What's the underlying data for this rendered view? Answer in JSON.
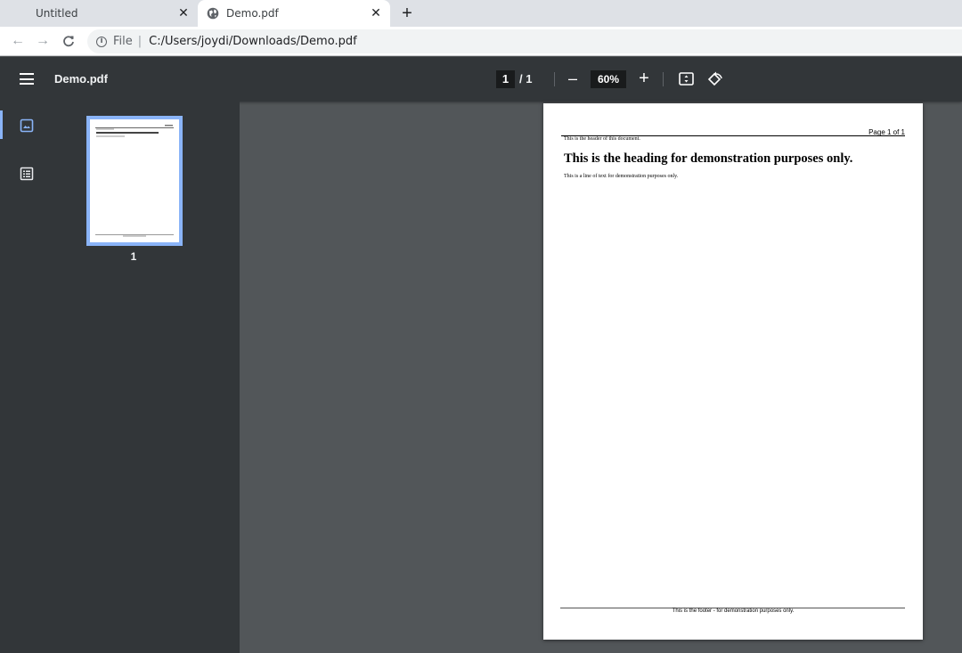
{
  "browser": {
    "tabs": [
      {
        "title": "Untitled",
        "close": "✕",
        "active": false
      },
      {
        "title": "Demo.pdf",
        "close": "✕",
        "active": true
      }
    ],
    "new_tab": "+",
    "address": {
      "scheme": "File",
      "separator": "|",
      "url": "C:/Users/joydi/Downloads/Demo.pdf"
    },
    "nav": {
      "back": "←",
      "forward": "→",
      "reload": "C"
    }
  },
  "viewer": {
    "title": "Demo.pdf",
    "page_current": "1",
    "page_total": "/ 1",
    "zoom": "60%",
    "zoom_out": "–",
    "zoom_in": "+"
  },
  "sidebar": {
    "thumbnails": [
      {
        "label": "1"
      }
    ]
  },
  "document": {
    "page_number": "Page 1 of 1",
    "header": "This is the header of this document.",
    "heading": "This is the heading for demonstration purposes only.",
    "body": "This is a line of text for demonstration purposes only.",
    "footer": "This is the footer - for demonstration purposes only."
  },
  "colors": {
    "viewer_toolbar": "#323639",
    "canvas": "#525659",
    "accent": "#8ab4f8"
  }
}
